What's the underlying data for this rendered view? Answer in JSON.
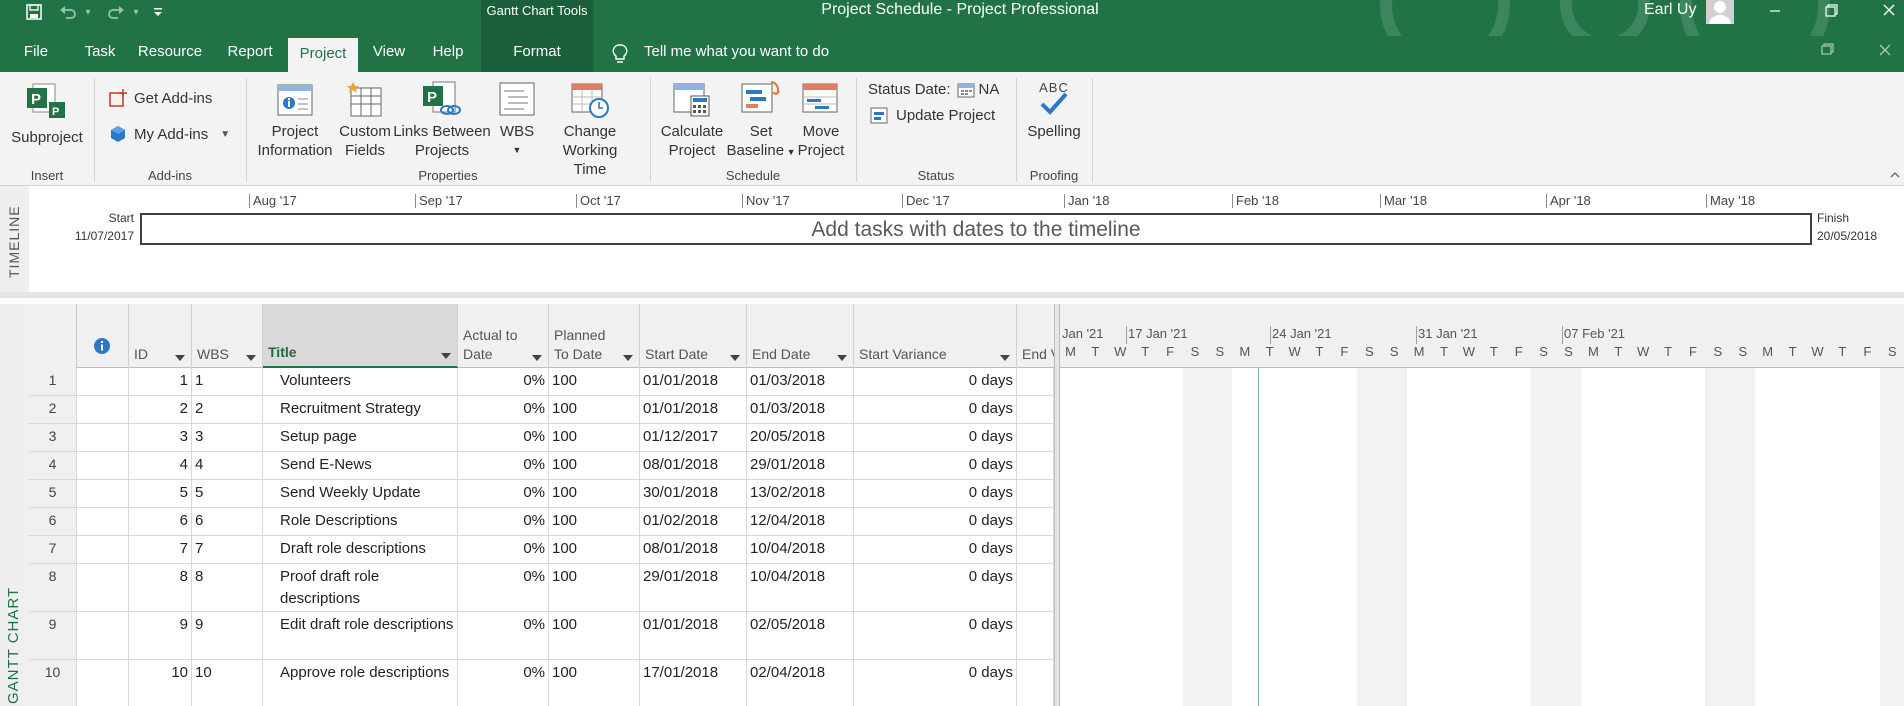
{
  "window": {
    "title": "Project Schedule  -  Project Professional",
    "contextual_tools": "Gantt Chart Tools",
    "user": "Earl Uy",
    "qat_dropdown": "▾"
  },
  "tabs": [
    "File",
    "Task",
    "Resource",
    "Report",
    "Project",
    "View",
    "Help",
    "Format"
  ],
  "active_tab": "Project",
  "tell_me": "Tell me what you want to do",
  "ribbon": {
    "subproject": "Subproject",
    "get_addins": "Get Add-ins",
    "my_addins": "My Add-ins",
    "project_information": [
      "Project",
      "Information"
    ],
    "custom_fields": [
      "Custom",
      "Fields"
    ],
    "links_between_projects": [
      "Links Between",
      "Projects"
    ],
    "wbs": "WBS",
    "change_working_time": [
      "Change",
      "Working Time"
    ],
    "calculate_project": [
      "Calculate",
      "Project"
    ],
    "set_baseline": [
      "Set",
      "Baseline"
    ],
    "move_project": [
      "Move",
      "Project"
    ],
    "status_date_label": "Status Date:",
    "status_date_value": "NA",
    "update_project": "Update Project",
    "spelling": "Spelling",
    "spelling_icon_text": "ABC",
    "groups": {
      "insert": "Insert",
      "addins": "Add-ins",
      "properties": "Properties",
      "schedule": "Schedule",
      "status": "Status",
      "proofing": "Proofing"
    }
  },
  "timeline": {
    "side_label": "TIMELINE",
    "start_label": "Start",
    "start_date": "11/07/2017",
    "finish_label": "Finish",
    "finish_date": "20/05/2018",
    "hint": "Add tasks with dates to the timeline",
    "months": [
      "Aug '17",
      "Sep '17",
      "Oct '17",
      "Nov '17",
      "Dec '17",
      "Jan '18",
      "Feb '18",
      "Mar '18",
      "Apr '18",
      "May '18"
    ]
  },
  "gantt": {
    "side_label": "GANTT CHART",
    "columns": {
      "id": "ID",
      "wbs": "WBS",
      "title": "Title",
      "actual_to_date": [
        "Actual to",
        "Date"
      ],
      "planned_to_date": [
        "Planned",
        "To Date"
      ],
      "start_date": "Start Date",
      "end_date": "End Date",
      "start_variance": "Start Variance",
      "end_variance": "End V"
    },
    "rows": [
      {
        "n": "1",
        "id": "1",
        "wbs": "1",
        "title": "Volunteers",
        "actual": "0%",
        "planned": "100",
        "start": "01/01/2018",
        "end": "01/03/2018",
        "variance": "0 days"
      },
      {
        "n": "2",
        "id": "2",
        "wbs": "2",
        "title": "Recruitment Strategy",
        "actual": "0%",
        "planned": "100",
        "start": "01/01/2018",
        "end": "01/03/2018",
        "variance": "0 days"
      },
      {
        "n": "3",
        "id": "3",
        "wbs": "3",
        "title": "Setup page",
        "actual": "0%",
        "planned": "100",
        "start": "01/12/2017",
        "end": "20/05/2018",
        "variance": "0 days"
      },
      {
        "n": "4",
        "id": "4",
        "wbs": "4",
        "title": "Send E-News",
        "actual": "0%",
        "planned": "100",
        "start": "08/01/2018",
        "end": "29/01/2018",
        "variance": "0 days"
      },
      {
        "n": "5",
        "id": "5",
        "wbs": "5",
        "title": "Send Weekly Update",
        "actual": "0%",
        "planned": "100",
        "start": "30/01/2018",
        "end": "13/02/2018",
        "variance": "0 days"
      },
      {
        "n": "6",
        "id": "6",
        "wbs": "6",
        "title": "Role Descriptions",
        "actual": "0%",
        "planned": "100",
        "start": "01/02/2018",
        "end": "12/04/2018",
        "variance": "0 days"
      },
      {
        "n": "7",
        "id": "7",
        "wbs": "7",
        "title": "Draft role descriptions",
        "actual": "0%",
        "planned": "100",
        "start": "08/01/2018",
        "end": "10/04/2018",
        "variance": "0 days"
      },
      {
        "n": "8",
        "id": "8",
        "wbs": "8",
        "title": "Proof draft role descriptions",
        "actual": "0%",
        "planned": "100",
        "start": "29/01/2018",
        "end": "10/04/2018",
        "variance": "0 days"
      },
      {
        "n": "9",
        "id": "9",
        "wbs": "9",
        "title": "Edit draft role descriptions",
        "actual": "0%",
        "planned": "100",
        "start": "01/01/2018",
        "end": "02/05/2018",
        "variance": "0 days"
      },
      {
        "n": "10",
        "id": "10",
        "wbs": "10",
        "title": "Approve role descriptions",
        "actual": "0%",
        "planned": "100",
        "start": "17/01/2018",
        "end": "02/04/2018",
        "variance": "0 days"
      }
    ],
    "chart": {
      "weeks": [
        "Jan '21",
        "17 Jan '21",
        "24 Jan '21",
        "31 Jan '21",
        "07 Feb '21"
      ],
      "days": [
        "M",
        "T",
        "W",
        "T",
        "F",
        "S",
        "S",
        "M",
        "T",
        "W",
        "T",
        "F",
        "S",
        "S",
        "M",
        "T",
        "W",
        "T",
        "F",
        "S",
        "S",
        "M",
        "T",
        "W",
        "T",
        "F",
        "S",
        "S",
        "M",
        "T",
        "W",
        "T",
        "F",
        "S"
      ]
    }
  },
  "colors": {
    "accent": "#217346",
    "ribbon_bg": "#f3f3f3",
    "header_bg": "#f0f0f0",
    "weekend_shade": "#f2f2f2"
  }
}
